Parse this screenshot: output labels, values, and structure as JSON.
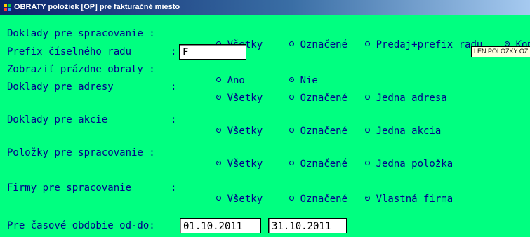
{
  "window": {
    "title": "OBRATY položiek [OP] pre fakturačné miesto",
    "colors": {
      "background": "#00ff80",
      "text": "#00008b",
      "titlebar": "#0a246a"
    }
  },
  "rows": {
    "doklady_spracovanie": {
      "label": "Doklady pre spracovanie :",
      "options": [
        {
          "label": "Všetky",
          "checked": false
        },
        {
          "label": "Označené",
          "checked": false
        },
        {
          "label": "Predaj+prefix radu",
          "checked": false
        },
        {
          "label": "Komis",
          "checked": true
        }
      ]
    },
    "prefix": {
      "label": "Prefix číselného radu",
      "colon": ":",
      "value": "F"
    },
    "badge": "LEN POLOŽKY OZ",
    "prazdne_obraty": {
      "label": "Zobraziť prázdne obraty :",
      "options": [
        {
          "label": "Ano",
          "checked": false
        },
        {
          "label": "Nie",
          "checked": true
        }
      ]
    },
    "adresy": {
      "label": "Doklady pre adresy",
      "colon": ":",
      "options": [
        {
          "label": "Všetky",
          "checked": true
        },
        {
          "label": "Označené",
          "checked": false
        },
        {
          "label": "Jedna adresa",
          "checked": false
        }
      ]
    },
    "akcie": {
      "label": "Doklady pre akcie",
      "colon": ":",
      "options": [
        {
          "label": "Všetky",
          "checked": true
        },
        {
          "label": "Označené",
          "checked": false
        },
        {
          "label": "Jedna akcia",
          "checked": false
        }
      ]
    },
    "polozky": {
      "label": "Položky pre spracovanie :",
      "options": [
        {
          "label": "Všetky",
          "checked": true
        },
        {
          "label": "Označené",
          "checked": false
        },
        {
          "label": "Jedna položka",
          "checked": false
        }
      ]
    },
    "firmy": {
      "label": "Firmy pre spracovanie",
      "colon": ":",
      "options": [
        {
          "label": "Všetky",
          "checked": false
        },
        {
          "label": "Označené",
          "checked": false
        },
        {
          "label": "Vlastná firma",
          "checked": true
        }
      ]
    },
    "obdobie": {
      "label": "Pre časové obdobie od-do:",
      "from": "01.10.2011",
      "to": "31.10.2011"
    }
  }
}
